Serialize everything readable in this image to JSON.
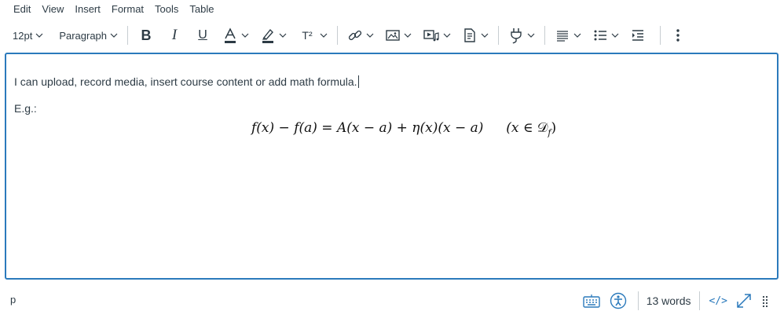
{
  "menubar": {
    "items": [
      "Edit",
      "View",
      "Insert",
      "Format",
      "Tools",
      "Table"
    ]
  },
  "toolbar": {
    "font_size": "12pt",
    "block_format": "Paragraph",
    "bold_label": "B",
    "italic_label": "I",
    "underline_label": "U",
    "superscript_label": "T²"
  },
  "editor": {
    "line1": "I can upload, record media, insert course content or add math formula.",
    "line2": "E.g.:",
    "formula": {
      "lhs": "f(x) − f(a) = A(x − a) + η(x)(x − a)",
      "cond_open": "(x ∈ ",
      "cond_D": "𝒟",
      "cond_sub": "f",
      "cond_close": ")"
    }
  },
  "statusbar": {
    "element_path": "p",
    "word_count": "13 words",
    "code_label": "</>"
  },
  "colors": {
    "accent": "#2b7abc",
    "text": "#2d3b45",
    "separator": "#c7cdd1"
  }
}
